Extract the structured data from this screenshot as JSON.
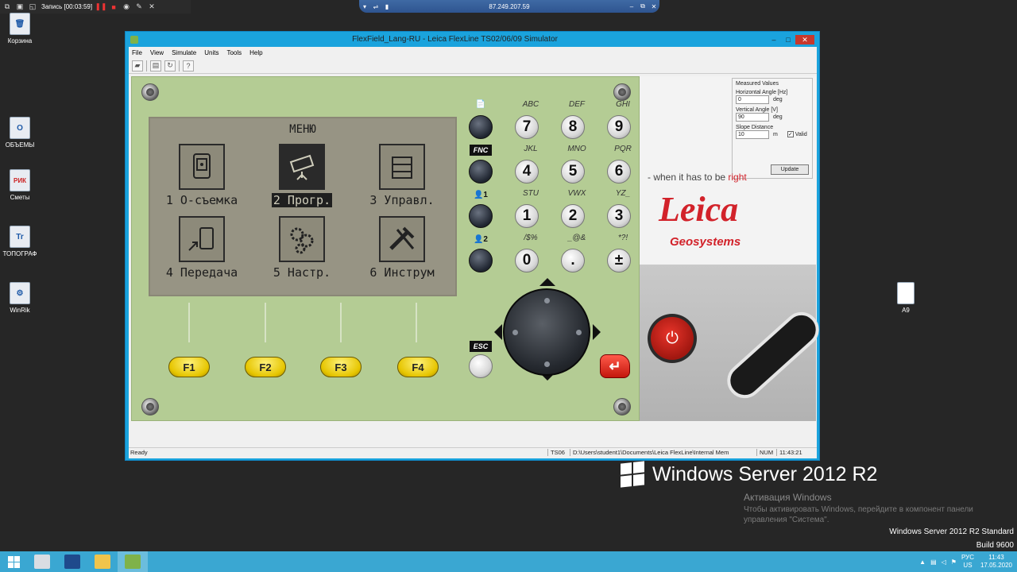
{
  "recording": {
    "label": "Запись [00:03:59]"
  },
  "rdp": {
    "host": "87.249.207.59"
  },
  "desktop": {
    "icons": [
      {
        "label": "Корзина"
      },
      {
        "label": "ОБЪЕМЫ"
      },
      {
        "label": "Сметы"
      },
      {
        "label": "ТОПОГРАФ"
      },
      {
        "label": "WinRik"
      },
      {
        "label": "А9"
      }
    ],
    "icon_glyphs": {
      "recycle": "🗑",
      "objemy": "O",
      "smety": "РИК",
      "topograf": "Tr",
      "winrik": "⚙",
      "a9": ""
    }
  },
  "window": {
    "title": "FlexField_Lang-RU - Leica FlexLine TS02/06/09 Simulator",
    "menu": [
      "File",
      "View",
      "Simulate",
      "Units",
      "Tools",
      "Help"
    ],
    "controls": {
      "minimize": "–",
      "maximize": "□",
      "close": "✕"
    }
  },
  "lcd": {
    "title": "МЕНЮ",
    "items": [
      {
        "label": "1 О-съемка",
        "icon": "surveying-icon"
      },
      {
        "label": "2 Прогр.",
        "icon": "programs-icon",
        "selected": true
      },
      {
        "label": "3 Управл.",
        "icon": "manage-icon"
      },
      {
        "label": "4 Передача",
        "icon": "transfer-icon"
      },
      {
        "label": "5 Настр.",
        "icon": "settings-icon"
      },
      {
        "label": "6 Инструм",
        "icon": "tools-icon"
      }
    ]
  },
  "keypad": {
    "side": [
      "📄",
      "FNC",
      "👤1",
      "👤2"
    ],
    "rows": [
      [
        {
          "key": "7",
          "letters": "ABC"
        },
        {
          "key": "8",
          "letters": "DEF"
        },
        {
          "key": "9",
          "letters": "GHI"
        }
      ],
      [
        {
          "key": "4",
          "letters": "JKL"
        },
        {
          "key": "5",
          "letters": "MNO"
        },
        {
          "key": "6",
          "letters": "PQR"
        }
      ],
      [
        {
          "key": "1",
          "letters": "STU"
        },
        {
          "key": "2",
          "letters": "VWX"
        },
        {
          "key": "3",
          "letters": "YZ_"
        }
      ],
      [
        {
          "key": "0",
          "letters": "/$%"
        },
        {
          "key": ".",
          "letters": "_@&"
        },
        {
          "key": "±",
          "letters": "*?!"
        }
      ]
    ],
    "fkeys": [
      "F1",
      "F2",
      "F3",
      "F4"
    ],
    "esc": "ESC",
    "enter": "↵"
  },
  "measured": {
    "group": "Measured Values",
    "hz_label": "Horizontal Angle [Hz]",
    "hz_value": "0",
    "hz_unit": "deg",
    "v_label": "Vertical Angle [V]",
    "v_value": "90",
    "v_unit": "deg",
    "sd_label": "Slope Distance",
    "sd_value": "10",
    "sd_unit": "m",
    "valid_label": "Valid",
    "valid_checked": "✓",
    "update": "Update"
  },
  "brand": {
    "tagline_pre": "- when it has to be ",
    "tagline_red": "right",
    "logo": "Leica",
    "sub": "Geosystems",
    "power": "⏻",
    "red": "#d2222a"
  },
  "statusbar": {
    "ready": "Ready",
    "model": "TS06",
    "path": "D:\\Users\\student1\\Documents\\Leica FlexLine\\Internal Mem",
    "num": "NUM",
    "time": "11:43:21"
  },
  "watermark": {
    "os": "Windows Server 2012 R2",
    "activate_title": "Активация Windows",
    "activate_text": "Чтобы активировать Windows, перейдите в компонент панели управления \"Система\".",
    "edition": "Windows Server 2012 R2 Standard",
    "build": "Build 9600"
  },
  "taskbar": {
    "lang_top": "РУС",
    "lang_bottom": "US",
    "clock_time": "11:43",
    "clock_date": "17.05.2020"
  }
}
